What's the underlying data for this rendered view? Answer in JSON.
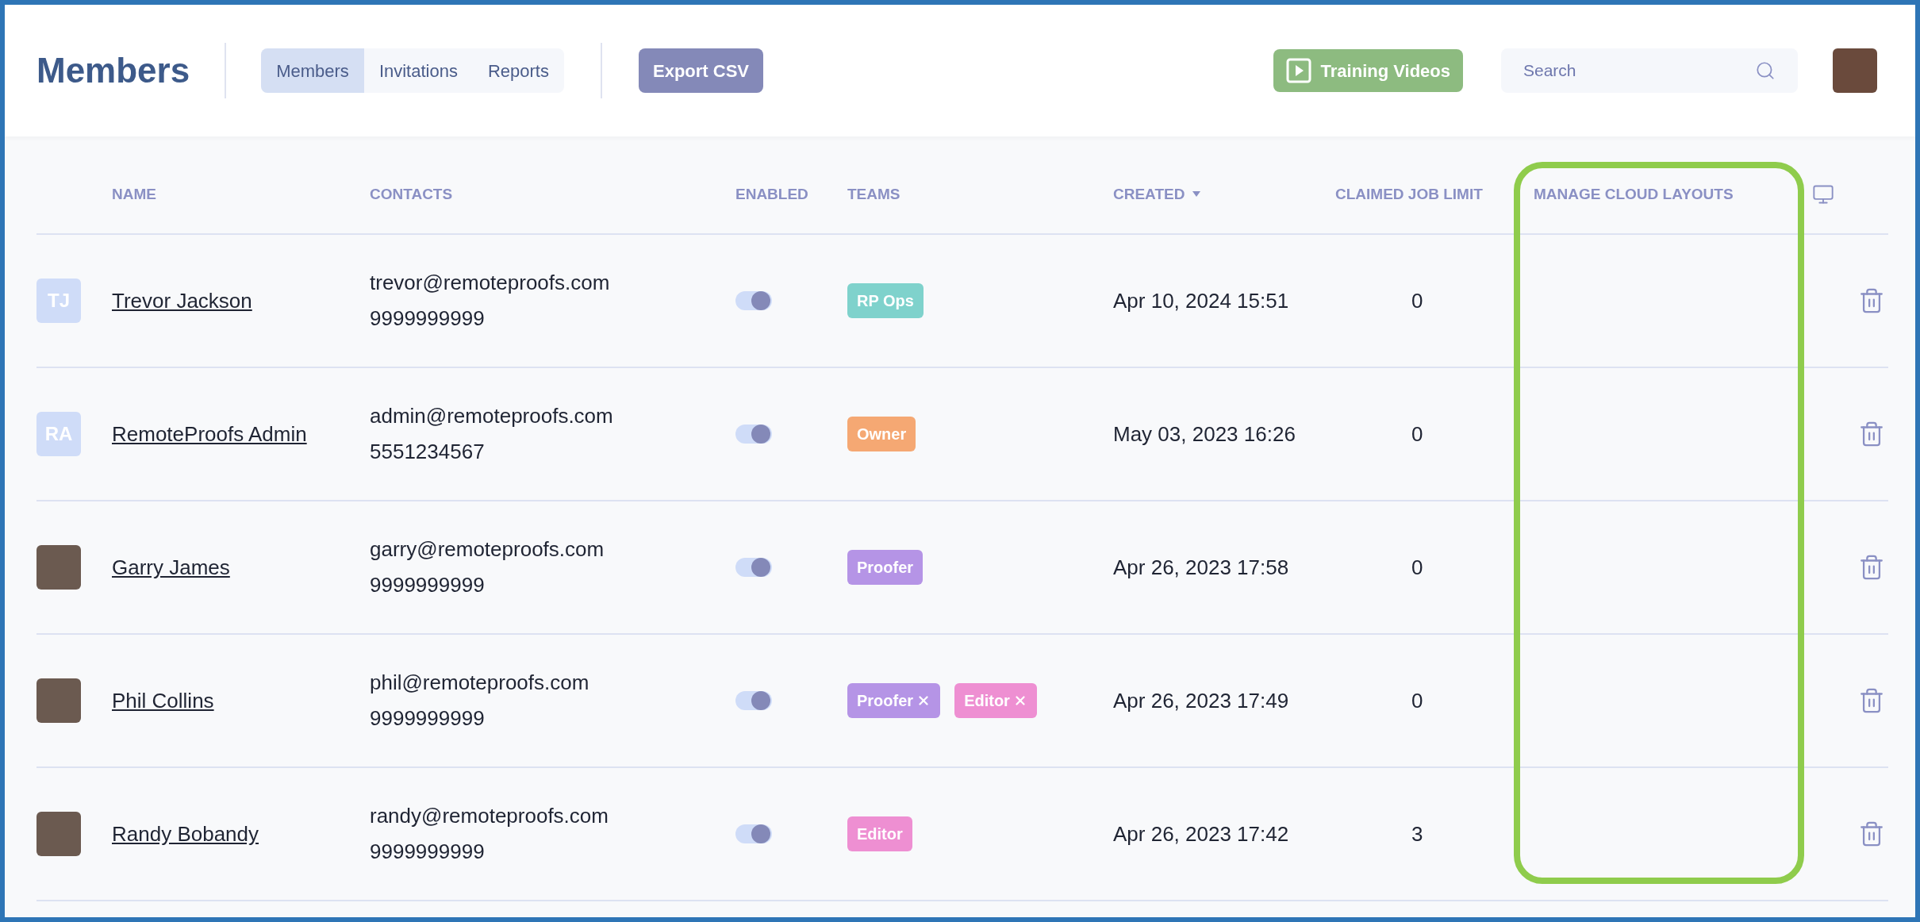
{
  "header": {
    "title": "Members",
    "tabs": [
      {
        "label": "Members",
        "selected": true
      },
      {
        "label": "Invitations",
        "selected": false
      },
      {
        "label": "Reports",
        "selected": false
      }
    ],
    "export_button": "Export CSV",
    "training_button": "Training Videos",
    "search": {
      "placeholder": "Search"
    }
  },
  "table": {
    "columns": [
      {
        "label": "NAME",
        "sorted": false
      },
      {
        "label": "CONTACTS",
        "sorted": false
      },
      {
        "label": "ENABLED",
        "sorted": false
      },
      {
        "label": "TEAMS",
        "sorted": false
      },
      {
        "label": "CREATED",
        "sorted": true
      },
      {
        "label": "CLAIMED JOB LIMIT",
        "sorted": false
      },
      {
        "label": "MANAGE CLOUD LAYOUTS",
        "sorted": false
      }
    ],
    "rows": [
      {
        "avatar": {
          "kind": "initials",
          "text": "TJ"
        },
        "name": "Trevor Jackson",
        "email": "trevor@remoteproofs.com",
        "phone": "9999999999",
        "enabled": true,
        "teams": [
          {
            "label": "RP Ops",
            "color": "#7fd2cc",
            "removable": false
          }
        ],
        "created": "Apr 10, 2024 15:51",
        "job_limit": "0"
      },
      {
        "avatar": {
          "kind": "initials",
          "text": "RA"
        },
        "name": "RemoteProofs Admin",
        "email": "admin@remoteproofs.com",
        "phone": "5551234567",
        "enabled": true,
        "teams": [
          {
            "label": "Owner",
            "color": "#f5a873",
            "removable": false
          }
        ],
        "created": "May 03, 2023 16:26",
        "job_limit": "0"
      },
      {
        "avatar": {
          "kind": "photo"
        },
        "name": "Garry James",
        "email": "garry@remoteproofs.com",
        "phone": "9999999999",
        "enabled": true,
        "teams": [
          {
            "label": "Proofer",
            "color": "#b594e6",
            "removable": false
          }
        ],
        "created": "Apr 26, 2023 17:58",
        "job_limit": "0"
      },
      {
        "avatar": {
          "kind": "photo"
        },
        "name": "Phil Collins",
        "email": "phil@remoteproofs.com",
        "phone": "9999999999",
        "enabled": true,
        "teams": [
          {
            "label": "Proofer",
            "color": "#b594e6",
            "removable": true
          },
          {
            "label": "Editor",
            "color": "#ee8fd2",
            "removable": true
          }
        ],
        "created": "Apr 26, 2023 17:49",
        "job_limit": "0"
      },
      {
        "avatar": {
          "kind": "photo"
        },
        "name": "Randy Bobandy",
        "email": "randy@remoteproofs.com",
        "phone": "9999999999",
        "enabled": true,
        "teams": [
          {
            "label": "Editor",
            "color": "#ee8fd2",
            "removable": false
          }
        ],
        "created": "Apr 26, 2023 17:42",
        "job_limit": "3"
      }
    ]
  }
}
